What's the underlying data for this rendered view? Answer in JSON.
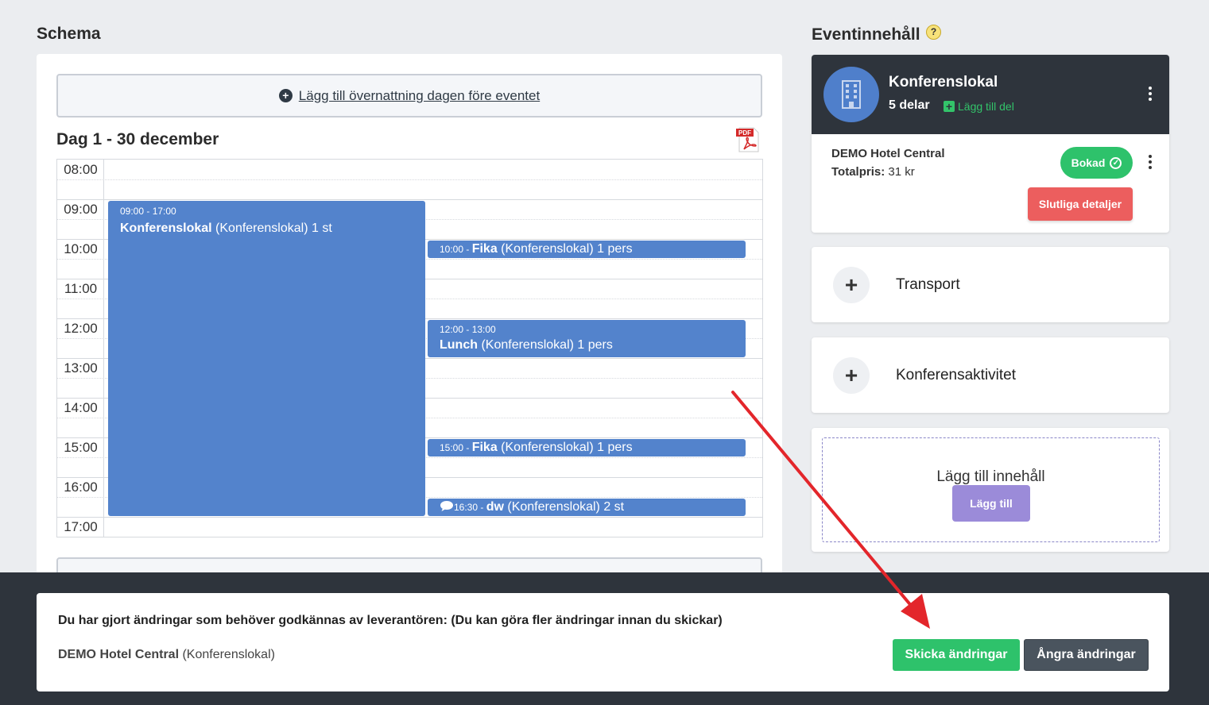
{
  "schedule": {
    "title": "Schema",
    "overnight_label": "Lägg till övernattning dagen före eventet",
    "day_title": "Dag 1 - 30 december",
    "pdf_icon": "pdf-icon",
    "pdf_text": "PDF",
    "times": [
      "08:00",
      "09:00",
      "10:00",
      "11:00",
      "12:00",
      "13:00",
      "14:00",
      "15:00",
      "16:00",
      "17:00"
    ],
    "events": [
      {
        "time": "09:00 - 17:00",
        "name": "Konferenslokal",
        "detail": " (Konferenslokal) 1 st"
      },
      {
        "time": "10:00 - ",
        "name": "Fika",
        "detail": " (Konferenslokal) 1 pers"
      },
      {
        "time": "12:00 - 13:00",
        "name": "Lunch",
        "detail": " (Konferenslokal) 1 pers"
      },
      {
        "time": "15:00 - ",
        "name": "Fika",
        "detail": " (Konferenslokal) 1 pers"
      },
      {
        "time": "16:30 - ",
        "name": "dw",
        "detail": " (Konferenslokal) 2 st",
        "icon": "comment-icon"
      }
    ]
  },
  "content": {
    "title": "Eventinnehåll",
    "help": "?",
    "venue": {
      "name": "Konferenslokal",
      "parts": "5 delar",
      "add_part": "Lägg till del",
      "hotel": "DEMO Hotel Central",
      "total_label": "Totalpris:",
      "total_value": " 31 kr",
      "status": "Bokad",
      "final_details": "Slutliga detaljer"
    },
    "add_items": [
      "Transport",
      "Konferensaktivitet"
    ],
    "add_content_title": "Lägg till innehåll",
    "add_button": "Lägg till"
  },
  "notice": {
    "message": "Du har gjort ändringar som behöver godkännas av leverantören: (Du kan göra fler ändringar innan du skickar)",
    "supplier": "DEMO Hotel Central",
    "supplier_detail": " (Konferenslokal)",
    "send_label": "Skicka ändringar",
    "undo_label": "Ångra ändringar"
  },
  "colors": {
    "event_blue": "#5383cc",
    "success_green": "#2ec26b",
    "danger_red": "#ec5e5e",
    "dark_header": "#2e343c",
    "purple": "#9b8bd9",
    "arrow_red": "#e3262b"
  }
}
